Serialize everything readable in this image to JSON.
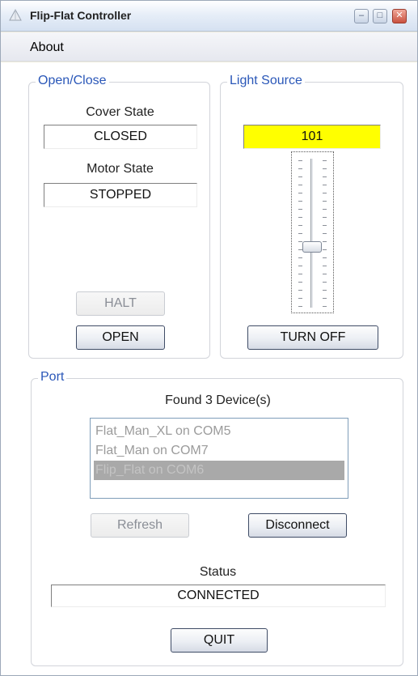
{
  "window": {
    "title": "Flip-Flat Controller",
    "min_glyph": "–",
    "max_glyph": "□",
    "close_glyph": "✕"
  },
  "menu": {
    "about": "About"
  },
  "open_close": {
    "title": "Open/Close",
    "cover_state_label": "Cover State",
    "cover_state_value": "CLOSED",
    "motor_state_label": "Motor State",
    "motor_state_value": "STOPPED",
    "halt_label": "HALT",
    "open_label": "OPEN"
  },
  "light_source": {
    "title": "Light Source",
    "brightness_value": "101",
    "brightness_level_fraction": 0.4,
    "turn_off_label": "TURN OFF",
    "accent_color": "#ffff00"
  },
  "port": {
    "title": "Port",
    "found_label": "Found 3 Device(s)",
    "devices": [
      "Flat_Man_XL on COM5",
      "Flat_Man on COM7",
      "Flip_Flat on COM6"
    ],
    "selected_index": 2,
    "refresh_label": "Refresh",
    "disconnect_label": "Disconnect",
    "status_label": "Status",
    "status_value": "CONNECTED",
    "quit_label": "QUIT"
  },
  "icons": [
    "app-icon",
    "minimize-icon",
    "maximize-icon",
    "close-icon"
  ]
}
